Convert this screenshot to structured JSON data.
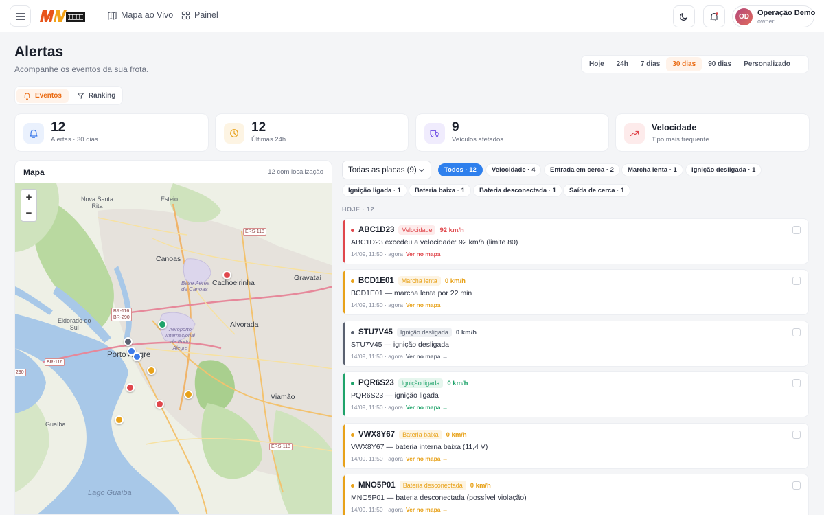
{
  "topbar": {
    "nav": [
      {
        "label": "Mapa ao Vivo",
        "icon": "map-icon"
      },
      {
        "label": "Painel",
        "icon": "grid-icon"
      }
    ],
    "user": {
      "initials": "OD",
      "name": "Operação Demo",
      "role": "owner"
    }
  },
  "header": {
    "title": "Alertas",
    "subtitle": "Acompanhe os eventos da sua frota.",
    "ranges": [
      "Hoje",
      "24h",
      "7 dias",
      "30 dias",
      "90 dias",
      "Personalizado"
    ],
    "active_range": "30 dias"
  },
  "view_tabs": [
    {
      "label": "Eventos",
      "icon": "bell-icon",
      "active": true
    },
    {
      "label": "Ranking",
      "icon": "trophy-icon",
      "active": false
    }
  ],
  "stats": [
    {
      "value": "12",
      "label": "Alertas · 30 dias",
      "icon": "bell-icon",
      "color": "#3d7bea",
      "bg": "#eaf1fd"
    },
    {
      "value": "12",
      "label": "Últimas 24h",
      "icon": "clock-icon",
      "color": "#e8a21a",
      "bg": "#fdf4e3"
    },
    {
      "value": "9",
      "label": "Veículos afetados",
      "icon": "truck-icon",
      "color": "#7b5ce6",
      "bg": "#f0ecfd"
    },
    {
      "value": "Velocidade",
      "label": "Tipo mais frequente",
      "icon": "trend-up-icon",
      "color": "#e0474c",
      "bg": "#fdebeb"
    }
  ],
  "map": {
    "title": "Mapa",
    "count": "12 com localização",
    "labels": {
      "nova_santa_rita": "Nova Santa\nRita",
      "esteio": "Esteio",
      "canoas": "Canoas",
      "cachoeirinha": "Cachoeirinha",
      "gravatai": "Gravataí",
      "base_aerea": "Base Aérea\nde Canoas",
      "eldorado": "Eldorado do\nSul",
      "alvorada": "Alvorada",
      "aeroporto": "Aeroporto\nInternacional\nde Porto\nAlegre",
      "porto_alegre": "Porto Alegre",
      "viamao": "Viamão",
      "guaiba": "Guaíba",
      "lago_guaiba": "Lago Guaíba",
      "ers118_a": "ERS-118",
      "ers118_b": "ERS-118",
      "br116_a": "BR-116\nBR-290",
      "br116_b": "BR-116",
      "br290": "290"
    },
    "zoom_in": "+",
    "zoom_out": "−"
  },
  "filters": {
    "plate_select": "Todas as placas (9)",
    "chips": [
      {
        "label": "Todos · 12",
        "active": true
      },
      {
        "label": "Velocidade · 4",
        "active": false
      },
      {
        "label": "Entrada em cerca · 2",
        "active": false
      },
      {
        "label": "Marcha lenta · 1",
        "active": false
      },
      {
        "label": "Ignição desligada · 1",
        "active": false
      },
      {
        "label": "Ignição ligada · 1",
        "active": false
      },
      {
        "label": "Bateria baixa · 1",
        "active": false
      },
      {
        "label": "Bateria desconectada · 1",
        "active": false
      },
      {
        "label": "Saída de cerca · 1",
        "active": false
      }
    ]
  },
  "day_label": "HOJE · 12",
  "alerts": [
    {
      "plate": "ABC1D23",
      "type": "Velocidade",
      "speed": "92 km/h",
      "message": "ABC1D23 excedeu a velocidade: 92 km/h (limite 80)",
      "time": "14/09, 11:50 · agora",
      "link": "Ver no mapa →",
      "color": "#e0474c",
      "tag_bg": "#fdebeb"
    },
    {
      "plate": "BCD1E01",
      "type": "Marcha lenta",
      "speed": "0 km/h",
      "message": "BCD1E01 — marcha lenta por 22 min",
      "time": "14/09, 11:50 · agora",
      "link": "Ver no mapa →",
      "color": "#e8a21a",
      "tag_bg": "#fdf4e3"
    },
    {
      "plate": "STU7V45",
      "type": "Ignição desligada",
      "speed": "0 km/h",
      "message": "STU7V45 — ignição desligada",
      "time": "14/09, 11:50 · agora",
      "link": "Ver no mapa →",
      "color": "#5a6170",
      "tag_bg": "#eef0f3"
    },
    {
      "plate": "PQR6S23",
      "type": "Ignição ligada",
      "speed": "0 km/h",
      "message": "PQR6S23 — ignição ligada",
      "time": "14/09, 11:50 · agora",
      "link": "Ver no mapa →",
      "color": "#1fa36a",
      "tag_bg": "#e6f6ee"
    },
    {
      "plate": "VWX8Y67",
      "type": "Bateria baixa",
      "speed": "0 km/h",
      "message": "VWX8Y67 — bateria interna baixa (11,4 V)",
      "time": "14/09, 11:50 · agora",
      "link": "Ver no mapa →",
      "color": "#e8a21a",
      "tag_bg": "#fdf4e3"
    },
    {
      "plate": "MNO5P01",
      "type": "Bateria desconectada",
      "speed": "0 km/h",
      "message": "MNO5P01 — bateria desconectada (possível violação)",
      "time": "14/09, 11:50 · agora",
      "link": "Ver no mapa →",
      "color": "#e8a21a",
      "tag_bg": "#fdf4e3"
    }
  ]
}
